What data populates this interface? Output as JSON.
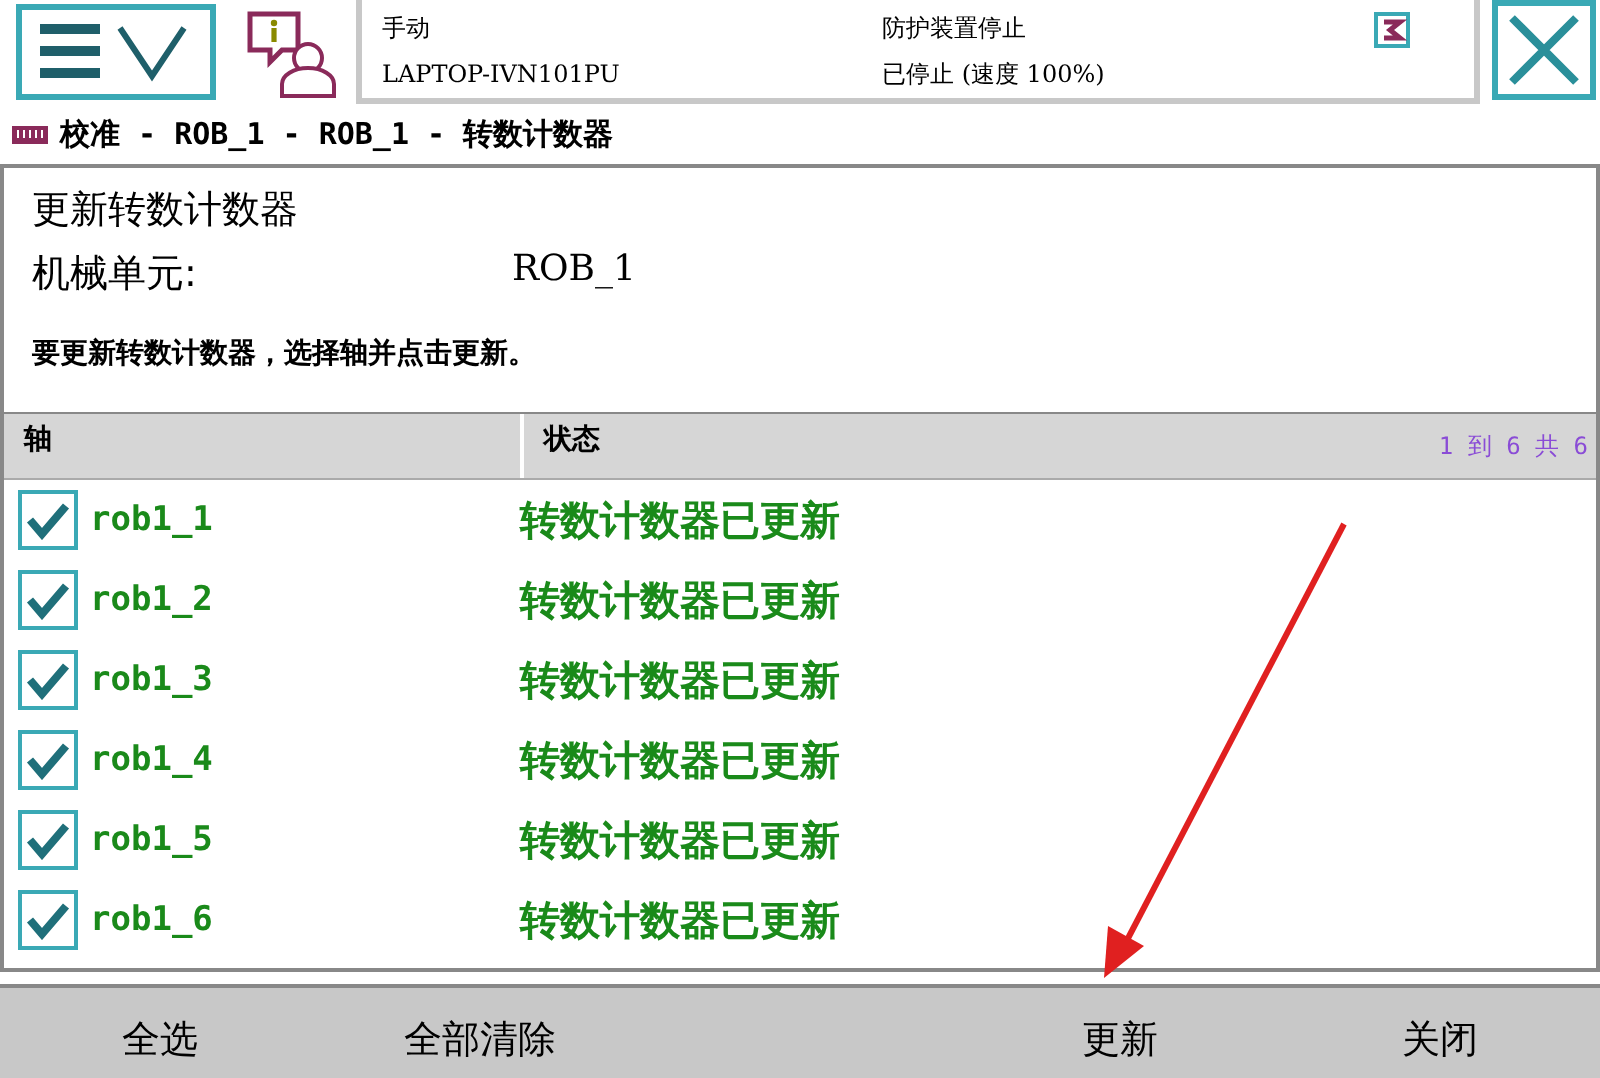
{
  "status": {
    "mode": "手动",
    "controller": "LAPTOP-IVN101PU",
    "safety": "防护装置停止",
    "state": "已停止 (速度 100%)"
  },
  "breadcrumb": "校准 - ROB_1 - ROB_1 - 转数计数器",
  "title": "更新转数计数器",
  "mech_unit": {
    "label": "机械单元:",
    "value": "ROB_1"
  },
  "instruction": "要更新转数计数器，选择轴并点击更新。",
  "table": {
    "columns": [
      "轴",
      "状态"
    ],
    "paging": "1 到 6 共 6",
    "rows": [
      {
        "axis": "rob1_1",
        "status": "转数计数器已更新",
        "checked": true
      },
      {
        "axis": "rob1_2",
        "status": "转数计数器已更新",
        "checked": true
      },
      {
        "axis": "rob1_3",
        "status": "转数计数器已更新",
        "checked": true
      },
      {
        "axis": "rob1_4",
        "status": "转数计数器已更新",
        "checked": true
      },
      {
        "axis": "rob1_5",
        "status": "转数计数器已更新",
        "checked": true
      },
      {
        "axis": "rob1_6",
        "status": "转数计数器已更新",
        "checked": true
      }
    ]
  },
  "toolbar": {
    "left": [
      "全选",
      "全部清除"
    ],
    "right": [
      "更新",
      "关闭"
    ]
  }
}
